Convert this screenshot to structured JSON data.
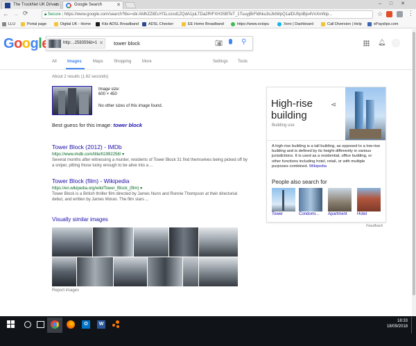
{
  "browser": {
    "tabs": [
      {
        "title": "The TruckNet UK Drivers"
      },
      {
        "title": "Google Search"
      }
    ],
    "address_secure": "Secure",
    "address_url": "https://www.google.com/search?tbs=sbi:AMhZZitEuYf1Lozxd1ZQdA1juLTDa2RIFXH3SBTeT_1TuuyjBrFldhku3sJktWpQ1alDUfqnBjo4VnXmNip..."
  },
  "bookmarks": [
    {
      "label": "LLU"
    },
    {
      "label": "Portal page"
    },
    {
      "label": "Digital UK - Home"
    },
    {
      "label": "Kitz ADSL Broadband"
    },
    {
      "label": "ADSL Checker"
    },
    {
      "label": "EE Home Broadband"
    },
    {
      "label": "https://www.octopu"
    },
    {
      "label": "Xero | Dashboard"
    },
    {
      "label": "Call Diversion | Help"
    },
    {
      "label": "ePayslips.com"
    }
  ],
  "google": {
    "logo": "Google",
    "image_chip": "http:...258359&t=1",
    "query": "tower block",
    "tabs": [
      "All",
      "Images",
      "Maps",
      "Shopping",
      "More"
    ],
    "settings": "Settings",
    "tools": "Tools",
    "stats": "About 2 results (1.62 seconds)"
  },
  "image_info": {
    "size_label": "Image size:",
    "size_value": "600 × 450",
    "no_other": "No other sizes of this image found."
  },
  "best_guess": {
    "label": "Best guess for this image:",
    "value": "tower block"
  },
  "results": [
    {
      "title": "Tower Block (2012) - IMDb",
      "url": "https://www.imdb.com/title/tt1992258/",
      "snippet": "Several months after witnessing a murder, residents of Tower Block 31 find themselves being picked off by a sniper, pitting those lucky enough to be alive into a ..."
    },
    {
      "title": "Tower Block (film) - Wikipedia",
      "url": "https://en.wikipedia.org/wiki/Tower_Block_(film)",
      "snippet": "Tower Block is a British thriller film directed by James Nunn and Ronnie Thompson at their directorial debut, and written by James Moran. The film stars ..."
    }
  ],
  "similar": {
    "heading": "Visually similar images",
    "report": "Report images"
  },
  "knowledge": {
    "title": "High-rise building",
    "subtitle": "Building use",
    "description": "A high-rise building is a tall building, as opposed to a low-rise building and is defined by its height differently in various jurisdictions. It is used as a residential, office building, or other functions including hotel, retail, or with multiple purposes combined.",
    "source": "Wikipedia",
    "people_heading": "People also search for",
    "people": [
      {
        "label": "Tower"
      },
      {
        "label": "Condomi..."
      },
      {
        "label": "Apartment"
      },
      {
        "label": "Hotel"
      }
    ],
    "feedback": "Feedback"
  },
  "taskbar": {
    "time": "18:33",
    "date": "18/09/2018"
  }
}
